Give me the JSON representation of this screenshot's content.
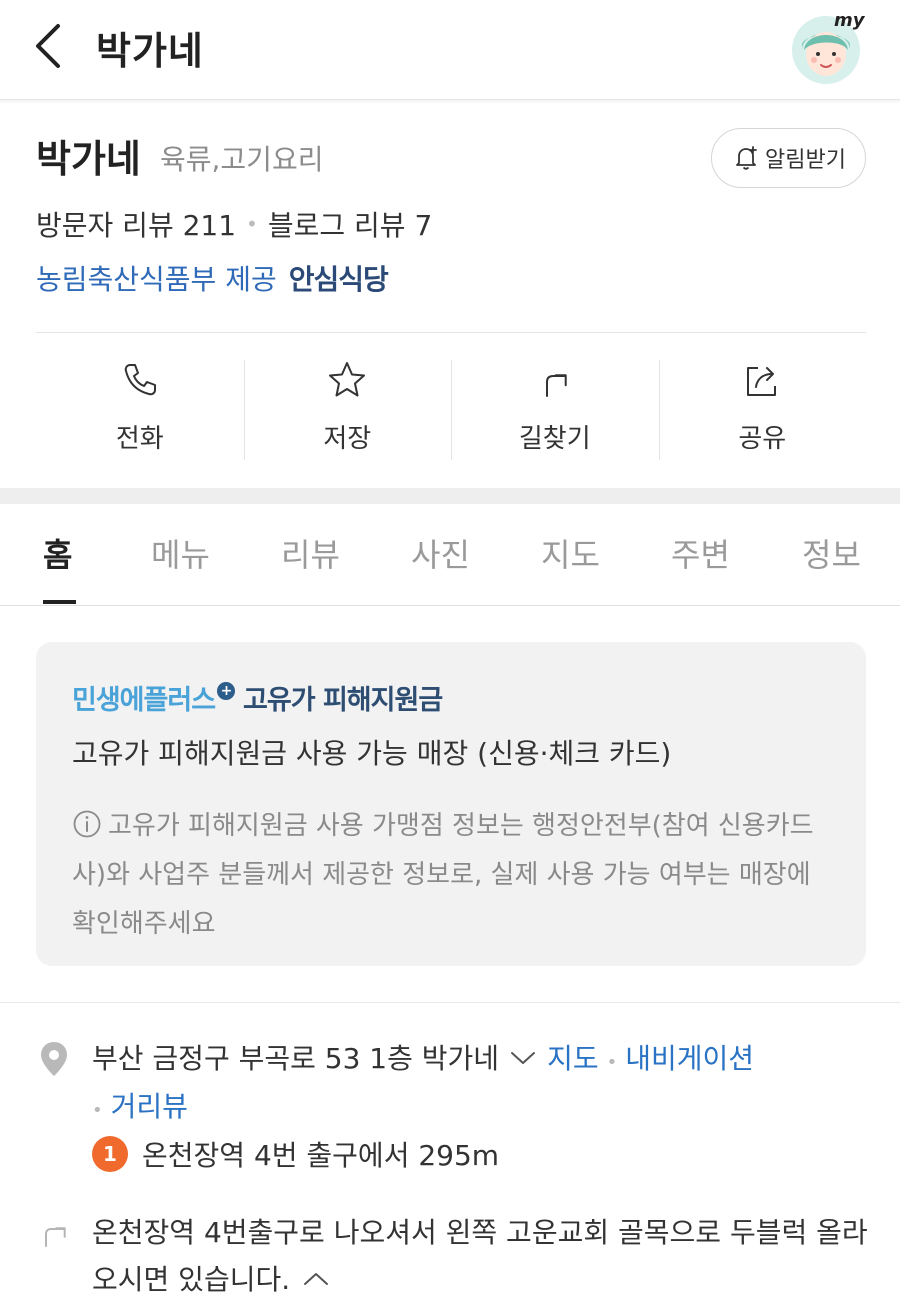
{
  "header": {
    "title": "박가네",
    "back_icon": "chevron-left-icon",
    "avatar_text": "my"
  },
  "store": {
    "name": "박가네",
    "category": "육류,고기요리",
    "notify_label": "알림받기",
    "visitor_review_label": "방문자 리뷰 211",
    "blog_review_label": "블로그 리뷰 7",
    "provider_text": "농림축산식품부 제공",
    "safe_badge": "안심식당"
  },
  "actions": [
    {
      "label": "전화",
      "icon": "phone-icon"
    },
    {
      "label": "저장",
      "icon": "star-icon"
    },
    {
      "label": "길찾기",
      "icon": "directions-icon"
    },
    {
      "label": "공유",
      "icon": "share-icon"
    }
  ],
  "tabs": [
    {
      "label": "홈",
      "active": true
    },
    {
      "label": "메뉴"
    },
    {
      "label": "리뷰"
    },
    {
      "label": "사진"
    },
    {
      "label": "지도"
    },
    {
      "label": "주변"
    },
    {
      "label": "정보"
    }
  ],
  "notice": {
    "brand_part1": "민생에플러스",
    "brand_plus": "+",
    "brand_part2": "고유가 피해지원금",
    "description": "고유가 피해지원금 사용 가능 매장 (신용·체크 카드)",
    "note": "고유가 피해지원금 사용 가맹점 정보는 행정안전부(참여 신용카드사)와 사업주 분들께서 제공한 정보로, 실제 사용 가능 여부는 매장에 확인해주세요"
  },
  "location": {
    "address": "부산 금정구 부곡로 53 1층 박가네",
    "map_link": "지도",
    "navigation_link": "내비게이션",
    "street_view_link": "거리뷰",
    "subway_line": "1",
    "subway_text": "온천장역 4번 출구에서 295m",
    "directions": "온천장역 4번출구로 나오셔서 왼쪽 고운교회 골목으로 두블럭 올라오시면 있습니다.",
    "accent_color": "#ef6a2c"
  }
}
